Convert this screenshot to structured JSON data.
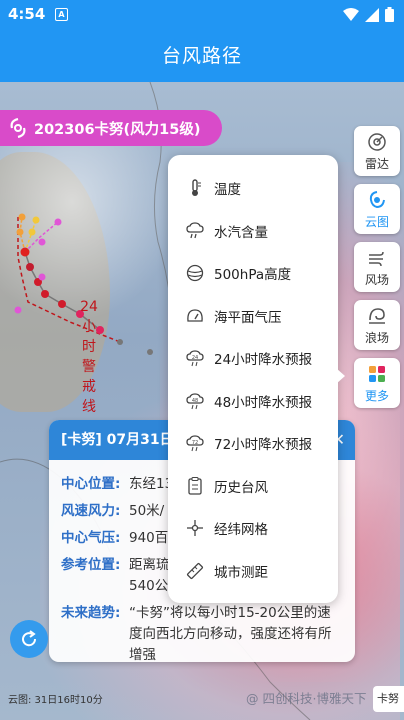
{
  "status_bar": {
    "time": "4:54",
    "notif_letter": "A"
  },
  "header": {
    "title": "台风路径"
  },
  "typhoon": {
    "label": "202306卡努(风力15级)",
    "color": "#d94bc9"
  },
  "map": {
    "warning_line": [
      "24",
      "小",
      "时",
      "警",
      "戒",
      "线"
    ]
  },
  "side_tools": [
    {
      "label": "雷达",
      "icon": "radar-icon"
    },
    {
      "label": "云图",
      "icon": "satellite-cloud-icon"
    },
    {
      "label": "风场",
      "icon": "wind-icon"
    },
    {
      "label": "浪场",
      "icon": "wave-icon"
    },
    {
      "label": "更多",
      "icon": "grid-more-icon"
    }
  ],
  "menu": [
    {
      "label": "温度",
      "icon": "thermometer-icon"
    },
    {
      "label": "水汽含量",
      "icon": "rain-cloud-icon"
    },
    {
      "label": "500hPa高度",
      "icon": "globe-icon"
    },
    {
      "label": "海平面气压",
      "icon": "gauge-icon"
    },
    {
      "label": "24小时降水预报",
      "icon": "rain-24-icon"
    },
    {
      "label": "48小时降水预报",
      "icon": "rain-48-icon"
    },
    {
      "label": "72小时降水预报",
      "icon": "rain-72-icon"
    },
    {
      "label": "历史台风",
      "icon": "history-doc-icon"
    },
    {
      "label": "经纬网格",
      "icon": "crosshair-icon"
    },
    {
      "label": "城市测距",
      "icon": "ruler-icon"
    }
  ],
  "info": {
    "header": "[卡努] 07月31日",
    "rows": [
      {
        "k": "中心位置:",
        "v": "东经13"
      },
      {
        "k": "风速风力:",
        "v": "50米/"
      },
      {
        "k": "中心气压:",
        "v": "940百"
      },
      {
        "k": "参考位置:",
        "v": "距离琉\n540公"
      },
      {
        "k": "未来趋势:",
        "v": "“卡努”将以每小时15-20公里的速度向西北方向移动，强度还将有所增强"
      }
    ]
  },
  "footer": {
    "cloud_time": "云图: 31日16时10分",
    "watermark": "@ 四创科技·博雅天下",
    "chip": "卡努"
  },
  "colors": {
    "primary": "#2196f3",
    "warning": "#c0161b",
    "accent": "#2e6fc7"
  }
}
